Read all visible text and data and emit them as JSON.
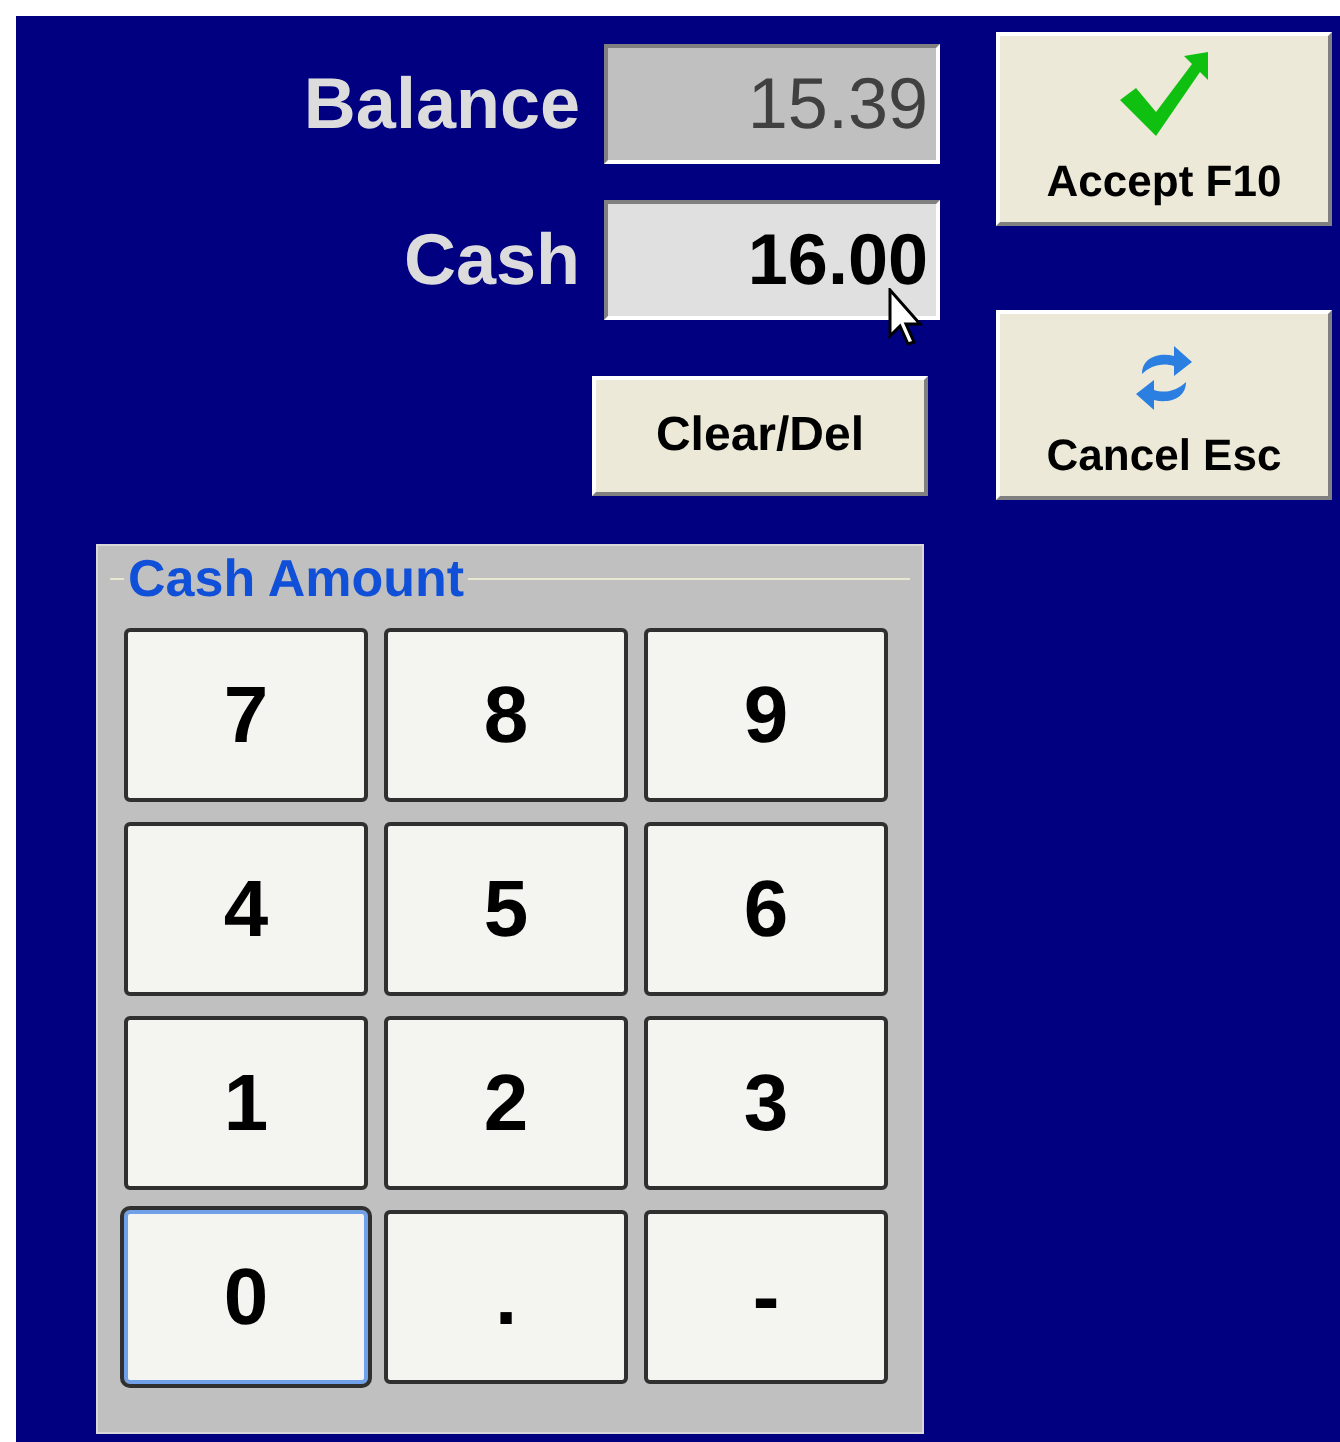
{
  "fields": [
    {
      "label": "Balance",
      "value": "15.39",
      "disabled": true
    },
    {
      "label": "Cash",
      "value": "16.00",
      "disabled": false
    }
  ],
  "clear_button": "Clear/Del",
  "actions": [
    {
      "label": "Accept F10",
      "kind": "accept"
    },
    {
      "label": "Cancel Esc",
      "kind": "cancel"
    }
  ],
  "keypad": {
    "title": "Cash Amount",
    "keys": [
      {
        "label": "7",
        "focused": false
      },
      {
        "label": "8",
        "focused": false
      },
      {
        "label": "9",
        "focused": false
      },
      {
        "label": "4",
        "focused": false
      },
      {
        "label": "5",
        "focused": false
      },
      {
        "label": "6",
        "focused": false
      },
      {
        "label": "1",
        "focused": false
      },
      {
        "label": "2",
        "focused": false
      },
      {
        "label": "3",
        "focused": false
      },
      {
        "label": "0",
        "focused": true
      },
      {
        "label": ".",
        "focused": false
      },
      {
        "label": "-",
        "focused": false
      }
    ]
  }
}
